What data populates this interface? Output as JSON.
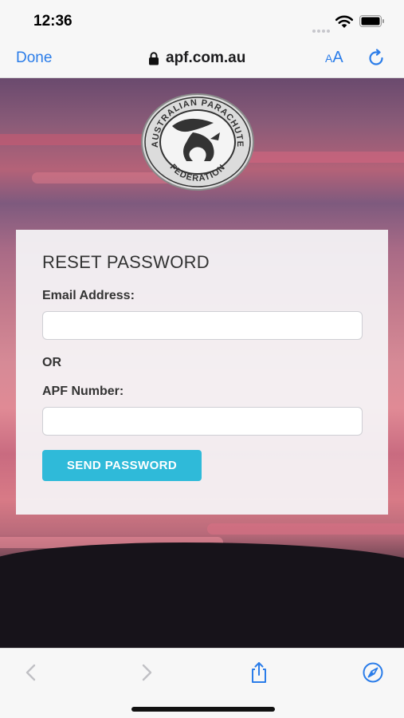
{
  "status_bar": {
    "time": "12:36",
    "icons": [
      "cellular-dots-icon",
      "wifi-icon",
      "battery-icon"
    ]
  },
  "browser": {
    "done_label": "Done",
    "url": "apf.com.au",
    "reader_small": "A",
    "reader_big": "A",
    "accent_color": "#2b7de9"
  },
  "logo": {
    "top_text": "AUSTRALIAN PARACHUTE",
    "bottom_text": "FEDERATION"
  },
  "reset_form": {
    "title": "RESET PASSWORD",
    "email_label": "Email Address:",
    "email_value": "",
    "or_label": "OR",
    "apf_label": "APF Number:",
    "apf_value": "",
    "send_button_label": "SEND PASSWORD",
    "button_color": "#2fbad9"
  },
  "toolbar": {
    "icons": [
      "back-arrow-icon",
      "forward-arrow-icon",
      "share-icon",
      "compass-icon"
    ]
  }
}
